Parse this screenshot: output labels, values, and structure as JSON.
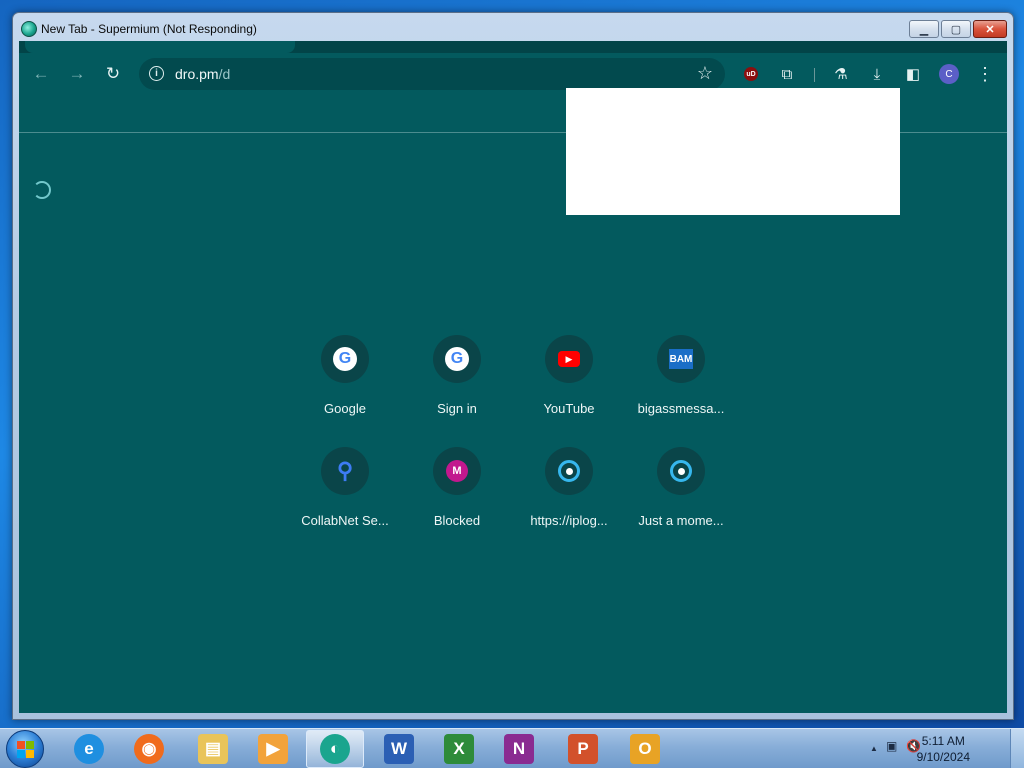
{
  "window": {
    "title": "New Tab - Supermium (Not Responding)",
    "buttons": {
      "minimize": "▁",
      "maximize": "▢",
      "close": "✕"
    }
  },
  "browser": {
    "toolbar": {
      "back_icon": "←",
      "forward_icon": "→",
      "reload_icon": "↻",
      "address": {
        "host": "dro.pm",
        "path": "/d",
        "info_icon": "i"
      },
      "bookmark_icon": "☆",
      "extensions": {
        "ublock_label": "uD",
        "puzzle_icon": "⧉",
        "labs_icon": "⚗",
        "download_icon": "⤓",
        "sidepanel_icon": "◧",
        "menu_icon": "⋮"
      },
      "profile_initial": "C"
    },
    "shortcuts": [
      {
        "label": "Google",
        "icon": "google-icon",
        "glyph": "G"
      },
      {
        "label": "Sign in",
        "icon": "google-icon",
        "glyph": "G"
      },
      {
        "label": "YouTube",
        "icon": "youtube-icon",
        "glyph": "▶"
      },
      {
        "label": "bigassmessa...",
        "icon": "bam-icon",
        "glyph": "BAM"
      },
      {
        "label": "CollabNet Se...",
        "icon": "search-icon",
        "glyph": "⚲"
      },
      {
        "label": "Blocked",
        "icon": "m-letter-icon",
        "glyph": "M"
      },
      {
        "label": "https://iplog...",
        "icon": "ring-icon",
        "glyph": ""
      },
      {
        "label": "Just a mome...",
        "icon": "ring-icon",
        "glyph": ""
      }
    ]
  },
  "taskbar": {
    "apps": [
      {
        "name": "internet-explorer",
        "glyph": "e",
        "color": "#1f8fe0"
      },
      {
        "name": "firefox",
        "glyph": "◉",
        "color": "#f06b1c"
      },
      {
        "name": "file-explorer",
        "glyph": "▤",
        "color": "#e9c45a"
      },
      {
        "name": "media-player",
        "glyph": "▶",
        "color": "#f2a33b"
      },
      {
        "name": "supermium",
        "glyph": "◐",
        "color": "#1aa58e"
      },
      {
        "name": "word",
        "glyph": "W",
        "color": "#2b5fb4"
      },
      {
        "name": "excel",
        "glyph": "X",
        "color": "#2e8b3a"
      },
      {
        "name": "onenote",
        "glyph": "N",
        "color": "#8a2b91"
      },
      {
        "name": "powerpoint",
        "glyph": "P",
        "color": "#d2512b"
      },
      {
        "name": "outlook",
        "glyph": "O",
        "color": "#e8a325"
      }
    ],
    "tray": {
      "chevron": "▲",
      "network_icon": "▣",
      "volume_icon": "🔇"
    },
    "clock": {
      "time": "5:11 AM",
      "date": "9/10/2024"
    }
  },
  "colors": {
    "page_bg": "#035a5e",
    "tile_bg": "#0a4549",
    "accent": "#73c8cc"
  }
}
